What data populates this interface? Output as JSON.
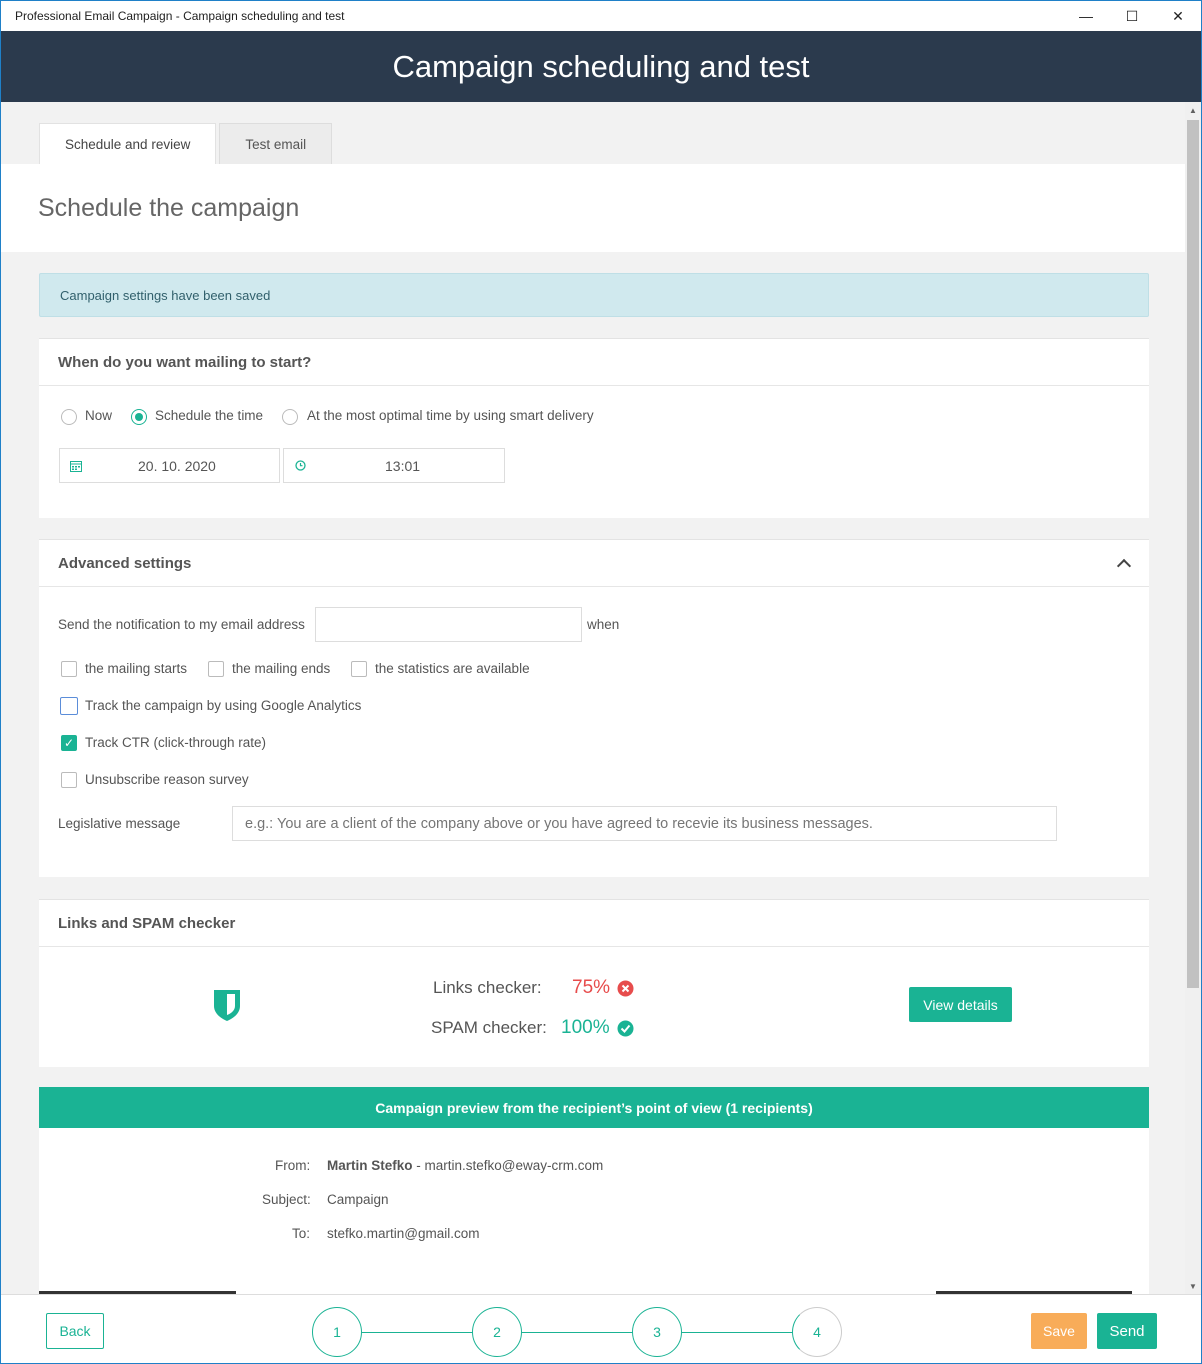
{
  "window": {
    "title": "Professional Email Campaign - Campaign scheduling and test",
    "minimize": "—",
    "maximize": "☐",
    "close": "✕"
  },
  "header": {
    "title": "Campaign scheduling and test"
  },
  "tabs": [
    {
      "label": "Schedule and review",
      "active": true
    },
    {
      "label": "Test email",
      "active": false
    }
  ],
  "page_title": "Schedule the campaign",
  "alert": {
    "text": "Campaign settings have been saved"
  },
  "when_section": {
    "title": "When do you want mailing to start?",
    "options": [
      {
        "label": "Now",
        "selected": false
      },
      {
        "label": "Schedule the time",
        "selected": true
      },
      {
        "label": "At the most optimal time by using smart delivery",
        "selected": false
      }
    ],
    "date_value": "20. 10. 2020",
    "time_value": "13:01"
  },
  "advanced": {
    "title": "Advanced settings",
    "notification_label": "Send the notification to my email address",
    "notification_value": "",
    "when_label": "when",
    "notify_options": [
      {
        "label": "the mailing starts",
        "checked": false
      },
      {
        "label": "the mailing ends",
        "checked": false
      },
      {
        "label": "the statistics are available",
        "checked": false
      }
    ],
    "google_analytics": {
      "label": "Track the campaign by using Google Analytics",
      "checked": false
    },
    "track_ctr": {
      "label": "Track CTR (click-through rate)",
      "checked": true
    },
    "unsubscribe_survey": {
      "label": "Unsubscribe reason survey",
      "checked": false
    },
    "legislative_label": "Legislative message",
    "legislative_placeholder": "e.g.: You are a client of the company above or you have agreed to recevie its business messages."
  },
  "checker": {
    "title": "Links and SPAM checker",
    "links_label": "Links checker:",
    "links_value": "75%",
    "links_status_color": "#e74c4c",
    "spam_label": "SPAM checker:",
    "spam_value": "100%",
    "spam_status_color": "#1ab394",
    "details_button": "View details"
  },
  "preview": {
    "title": "Campaign preview from the recipient’s point of view (1 recipients)",
    "from_label": "From:",
    "from_name": "Martin Stefko",
    "from_email": " - martin.stefko@eway-crm.com",
    "subject_label": "Subject:",
    "subject_value": "Campaign",
    "to_label": "To:",
    "to_value": "stefko.martin@gmail.com"
  },
  "footer": {
    "back": "Back",
    "steps": [
      "1",
      "2",
      "3",
      "4"
    ],
    "save": "Save",
    "send": "Send"
  },
  "colors": {
    "accent": "#1ab394",
    "header_bg": "#2b3a4d",
    "save_bg": "#f8ac59",
    "error": "#e74c4c"
  }
}
